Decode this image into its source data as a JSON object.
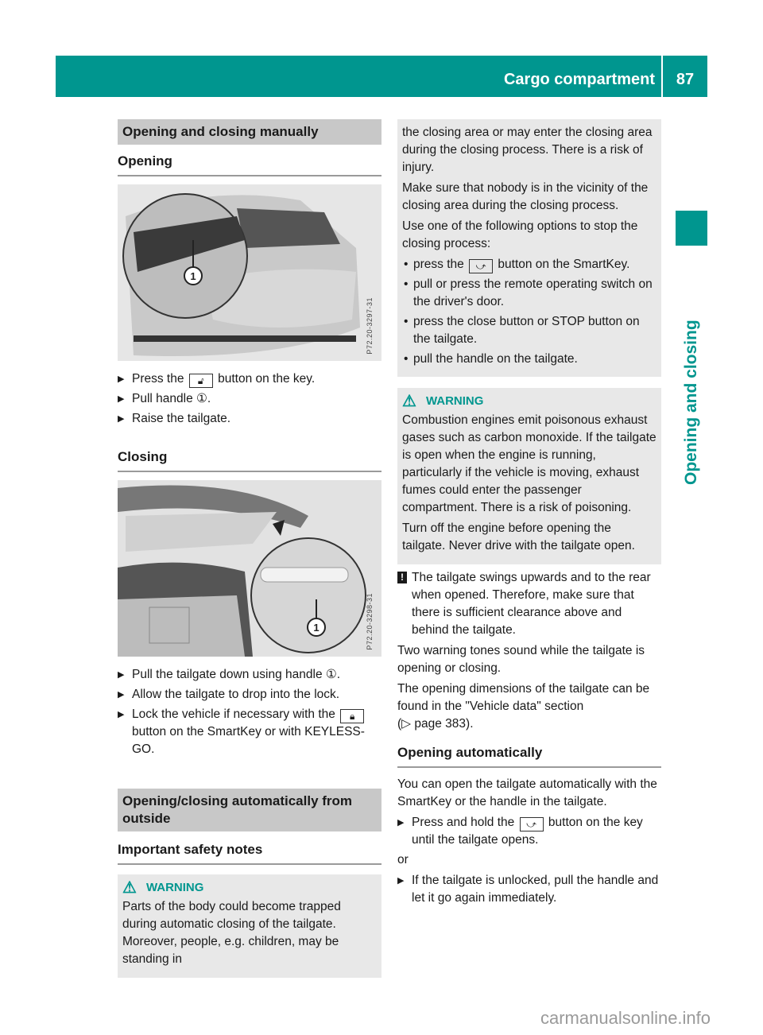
{
  "header": {
    "section_title": "Cargo compartment",
    "page_number": "87",
    "side_tab_label": "Opening and closing",
    "accent_color": "#00968f"
  },
  "left": {
    "heading_manual": "Opening and closing manually",
    "sub_opening": "Opening",
    "figure1": {
      "code": "P72.20-3297-31",
      "callout": "1"
    },
    "opening_steps": [
      {
        "before": "Press the",
        "icon": "unlock-icon",
        "after": "button on the key."
      },
      {
        "text": "Pull handle ①."
      },
      {
        "text": "Raise the tailgate."
      }
    ],
    "sub_closing": "Closing",
    "figure2": {
      "code": "P72.20-3298-31",
      "callout": "1"
    },
    "closing_steps": [
      {
        "text": "Pull the tailgate down using handle ①."
      },
      {
        "text": "Allow the tailgate to drop into the lock."
      },
      {
        "before": "Lock the vehicle if necessary with the",
        "icon": "lock-icon",
        "after": "button on the SmartKey or with KEYLESS-GO."
      }
    ],
    "heading_auto": "Opening/closing automatically from outside",
    "sub_safety": "Important safety notes",
    "warning1": {
      "label": "WARNING",
      "text": "Parts of the body could become trapped during automatic closing of the tailgate. Moreover, people, e.g. children, may be standing in"
    }
  },
  "right": {
    "warning1_cont": {
      "p1": "the closing area or may enter the closing area during the closing process. There is a risk of injury.",
      "p2": "Make sure that nobody is in the vicinity of the closing area during the closing process.",
      "p3": "Use one of the following options to stop the closing process:",
      "bullets": [
        {
          "before": "press the",
          "icon": "tailgate-icon",
          "after": "button on the SmartKey."
        },
        {
          "text": "pull or press the remote operating switch on the driver's door."
        },
        {
          "text": "press the close button or STOP button on the tailgate."
        },
        {
          "text": "pull the handle on the tailgate."
        }
      ]
    },
    "warning2": {
      "label": "WARNING",
      "p1": "Combustion engines emit poisonous exhaust gases such as carbon monoxide. If the tailgate is open when the engine is running, particularly if the vehicle is moving, exhaust fumes could enter the passenger compartment. There is a risk of poisoning.",
      "p2": "Turn off the engine before opening the tailgate. Never drive with the tailgate open."
    },
    "note": "The tailgate swings upwards and to the rear when opened. Therefore, make sure that there is sufficient clearance above and behind the tailgate.",
    "para_tones": "Two warning tones sound while the tailgate is opening or closing.",
    "para_dimensions": "The opening dimensions of the tailgate can be found in the \"Vehicle data\" section",
    "page_ref": "(▷ page 383).",
    "sub_auto_open": "Opening automatically",
    "auto_intro": "You can open the tailgate automatically with the SmartKey or the handle in the tailgate.",
    "auto_step1": {
      "before": "Press and hold the",
      "icon": "tailgate-icon",
      "after": "button on the key until the tailgate opens."
    },
    "or_label": "or",
    "auto_step2": "If the tailgate is unlocked, pull the handle and let it go again immediately."
  },
  "footer": {
    "watermark": "carmanualsonline.info"
  }
}
